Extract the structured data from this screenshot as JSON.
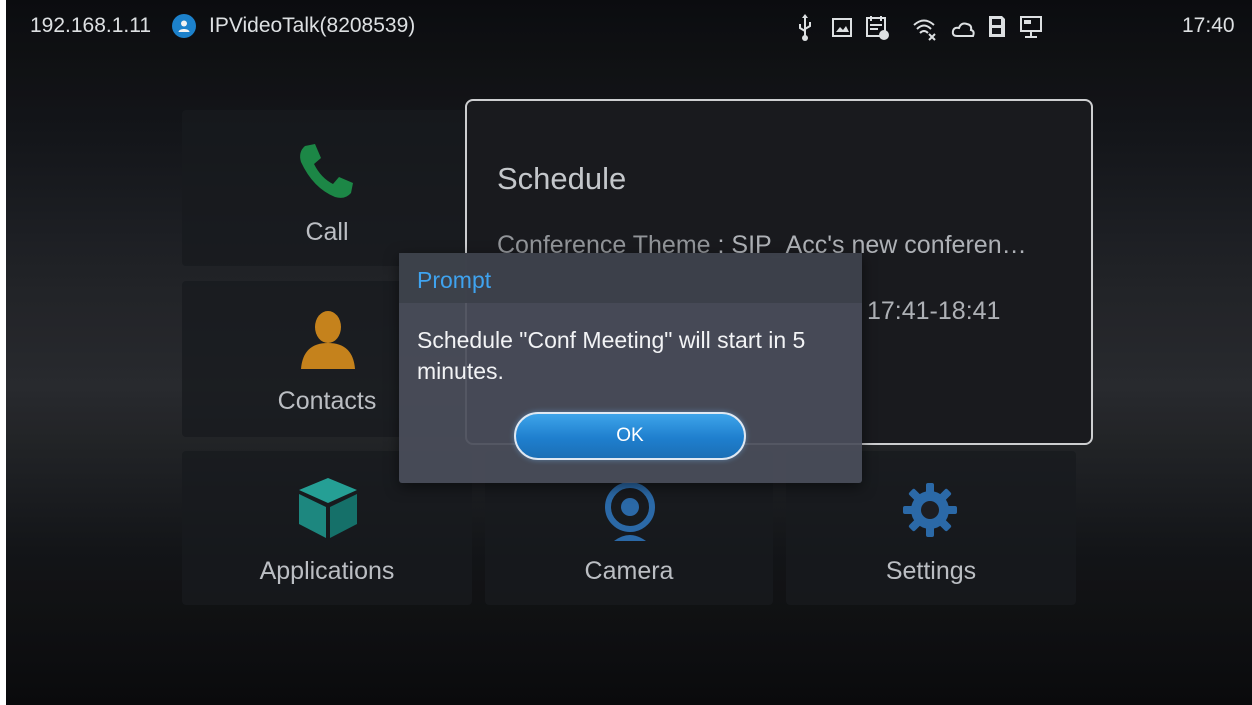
{
  "status_bar": {
    "ip": "192.168.1.11",
    "account": "IPVideoTalk(8208539)",
    "time": "17:40",
    "icons": [
      "usb-icon",
      "screenshot-icon",
      "calendar-icon",
      "wifi-off-icon",
      "cloud-icon",
      "sd-card-icon",
      "monitor-icon"
    ]
  },
  "tiles": {
    "call": "Call",
    "contacts": "Contacts",
    "applications": "Applications",
    "camera": "Camera",
    "settings": "Settings"
  },
  "schedule": {
    "title": "Schedule",
    "theme_label": "Conference Theme",
    "theme_separator": " : ",
    "theme_value": "SIP_Acc's new conferen…",
    "time_value": "17:41-18:41"
  },
  "dialog": {
    "title": "Prompt",
    "message": "Schedule \"Conf Meeting\" will start in 5 minutes.",
    "ok_label": "OK"
  },
  "colors": {
    "accent_blue": "#3fa3ef",
    "call_green": "#1e8f4a",
    "contacts_orange": "#d08a1e",
    "apps_teal": "#1f8f86",
    "button_blue": "#1f7fce"
  }
}
